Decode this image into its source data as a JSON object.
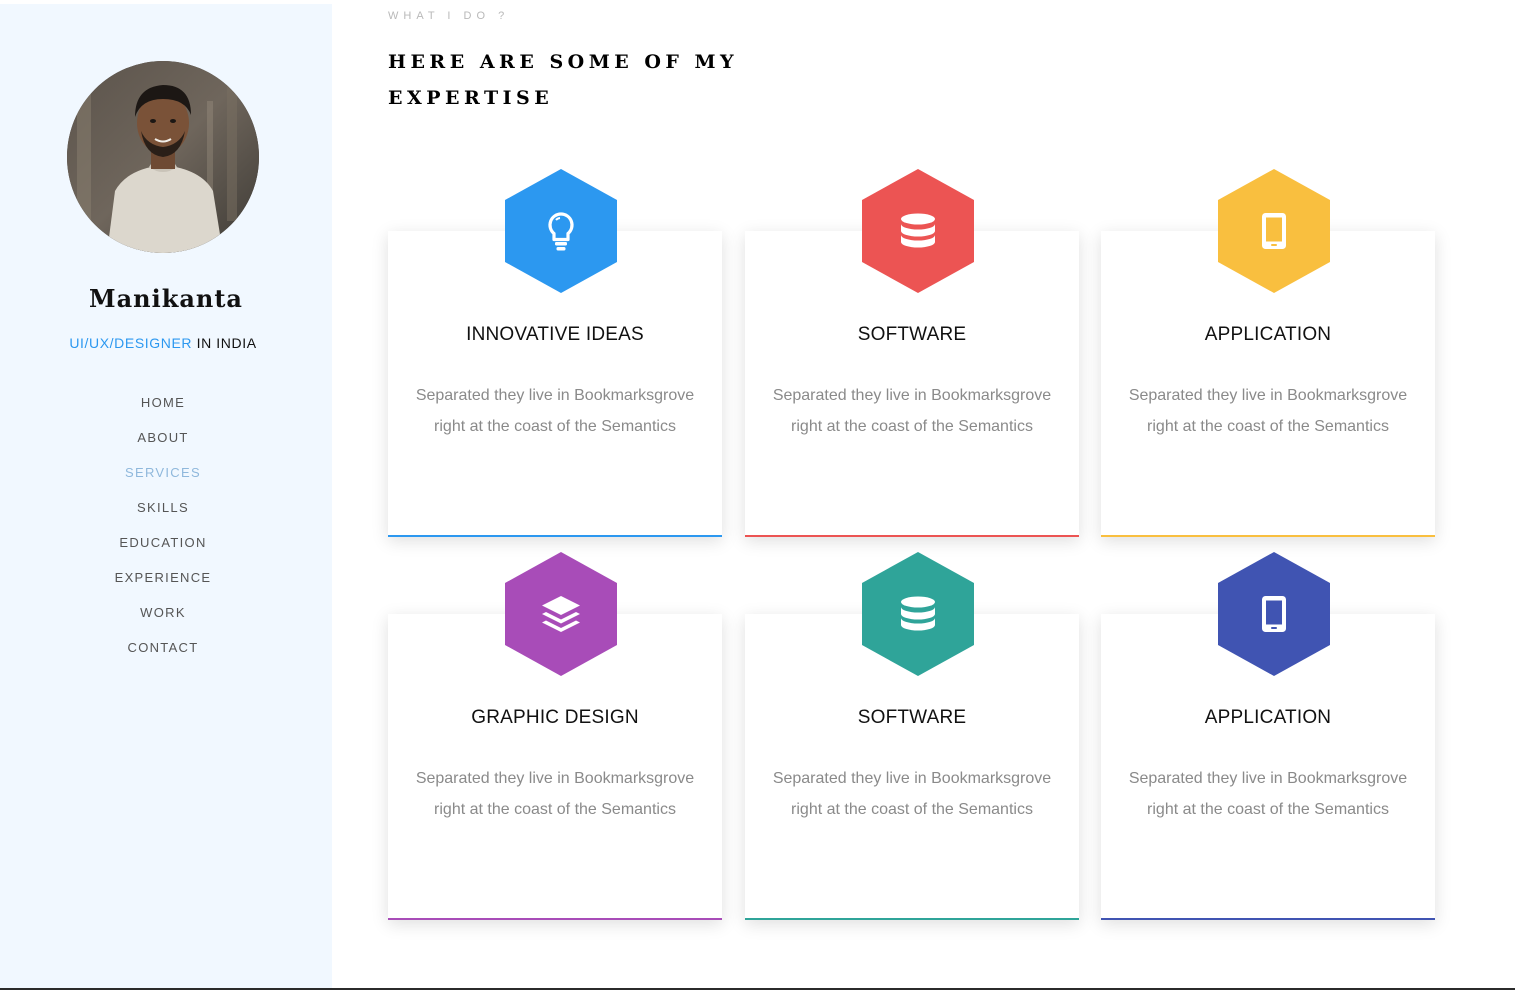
{
  "sidebar": {
    "name": "Manikanta",
    "role_highlight": "UI/UX/DESIGNER",
    "role_suffix": " IN INDIA",
    "nav": [
      {
        "label": "HOME",
        "active": false
      },
      {
        "label": "ABOUT",
        "active": false
      },
      {
        "label": "SERVICES",
        "active": true
      },
      {
        "label": "SKILLS",
        "active": false
      },
      {
        "label": "EDUCATION",
        "active": false
      },
      {
        "label": "EXPERIENCE",
        "active": false
      },
      {
        "label": "WORK",
        "active": false
      },
      {
        "label": "CONTACT",
        "active": false
      }
    ]
  },
  "main": {
    "eyebrow": "WHAT I DO ?",
    "heading": "HERE ARE SOME OF MY EXPERTISE",
    "cards": [
      {
        "title": "INNOVATIVE IDEAS",
        "description": "Separated they live in Bookmarksgrove right at the coast of the Semantics",
        "color": "#2c98f0",
        "icon": "lightbulb-icon"
      },
      {
        "title": "SOFTWARE",
        "description": "Separated they live in Bookmarksgrove right at the coast of the Semantics",
        "color": "#ec5453",
        "icon": "database-icon"
      },
      {
        "title": "APPLICATION",
        "description": "Separated they live in Bookmarksgrove right at the coast of the Semantics",
        "color": "#f9bf3f",
        "icon": "mobile-icon"
      },
      {
        "title": "GRAPHIC DESIGN",
        "description": "Separated they live in Bookmarksgrove right at the coast of the Semantics",
        "color": "#a84cb8",
        "icon": "layers-icon"
      },
      {
        "title": "SOFTWARE",
        "description": "Separated they live in Bookmarksgrove right at the coast of the Semantics",
        "color": "#2fa499",
        "icon": "database-icon"
      },
      {
        "title": "APPLICATION",
        "description": "Separated they live in Bookmarksgrove right at the coast of the Semantics",
        "color": "#4054b2",
        "icon": "mobile-icon"
      }
    ]
  },
  "colors": {
    "accent": "#2c98f0",
    "sidebar_bg": "#f1f8ff",
    "nav_active": "#8fb8dc",
    "text_muted": "#8a8a8a"
  }
}
